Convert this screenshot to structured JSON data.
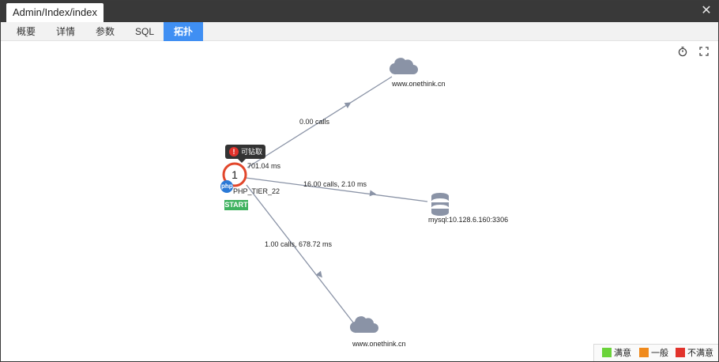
{
  "window": {
    "title": "Admin/Index/index",
    "close_glyph": "✕"
  },
  "tabs": [
    {
      "label": "概要"
    },
    {
      "label": "详情"
    },
    {
      "label": "参数"
    },
    {
      "label": "SQL"
    },
    {
      "label": "拓扑",
      "active": true
    }
  ],
  "toolbar": {
    "timer_icon": "stopwatch-icon",
    "fullscreen_icon": "fullscreen-icon"
  },
  "topology": {
    "app_node": {
      "count": "1",
      "name": "PHP_TIER_22",
      "php_badge": "php",
      "time": "701.04 ms",
      "start_label": "START",
      "tooltip": "可钻取",
      "status_color": "#e2472c"
    },
    "edges": [
      {
        "label": "0.00 calls"
      },
      {
        "label": "16.00 calls, 2.10 ms"
      },
      {
        "label": "1.00 calls, 678.72 ms"
      }
    ],
    "targets": [
      {
        "name": "www.onethink.cn",
        "icon": "cloud-icon"
      },
      {
        "name": "mysql:10.128.6.160:3306",
        "icon": "database-icon"
      },
      {
        "name": "www.onethink.cn",
        "icon": "cloud-icon"
      }
    ]
  },
  "legend": [
    {
      "label": "满意",
      "color": "#6bd33a"
    },
    {
      "label": "一般",
      "color": "#f08a1c"
    },
    {
      "label": "不满意",
      "color": "#e2332c"
    }
  ]
}
